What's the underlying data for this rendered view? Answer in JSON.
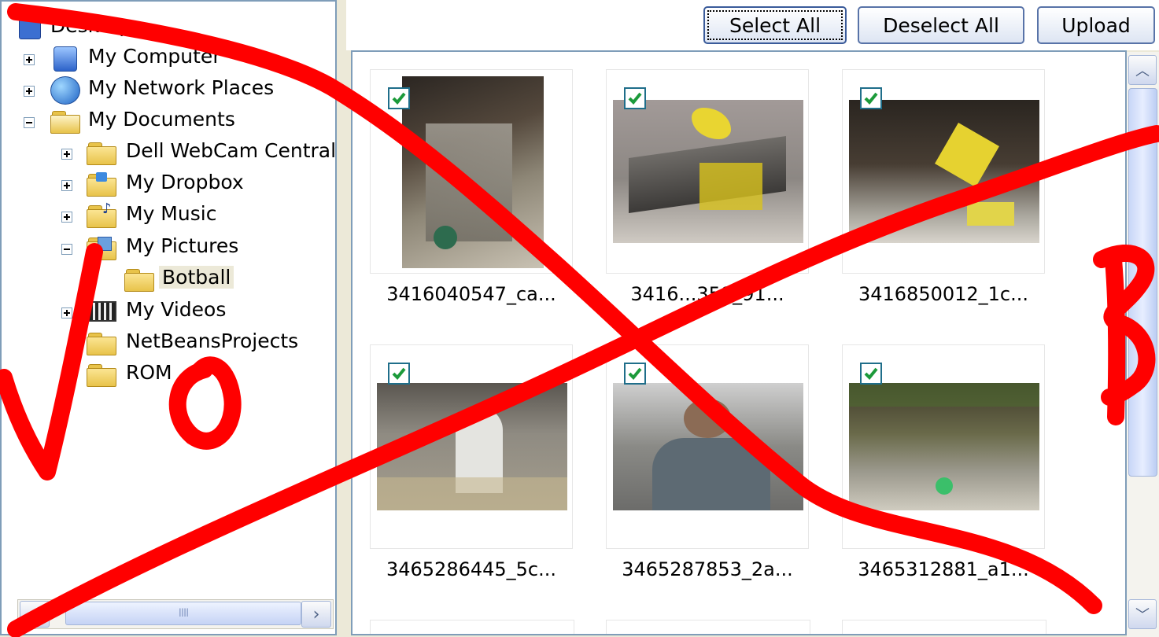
{
  "tree": {
    "items": [
      {
        "label": "Desktop",
        "kind": "desktop"
      },
      {
        "label": "My Computer",
        "kind": "computer"
      },
      {
        "label": "My Network Places",
        "kind": "network"
      },
      {
        "label": "My Documents",
        "kind": "documents"
      },
      {
        "label": "Dell WebCam Central",
        "kind": "folder"
      },
      {
        "label": "My Dropbox",
        "kind": "dropbox"
      },
      {
        "label": "My Music",
        "kind": "music"
      },
      {
        "label": "My Pictures",
        "kind": "pictures"
      },
      {
        "label": "Botball",
        "kind": "folder",
        "selected": true
      },
      {
        "label": "My Videos",
        "kind": "videos"
      },
      {
        "label": "NetBeansProjects",
        "kind": "folder"
      },
      {
        "label": "ROM",
        "kind": "folder"
      }
    ],
    "hscroll_grip": "IIII"
  },
  "toolbar": {
    "select_all": "Select All",
    "deselect_all": "Deselect All",
    "upload": "Upload"
  },
  "gallery": {
    "photos": [
      {
        "caption": "3416040547_ca...",
        "checked": true
      },
      {
        "caption": "3416...358_91...",
        "checked": true
      },
      {
        "caption": "3416850012_1c...",
        "checked": true
      },
      {
        "caption": "3465286445_5c...",
        "checked": true
      },
      {
        "caption": "3465287853_2a...",
        "checked": true
      },
      {
        "caption": "3465312881_a1...",
        "checked": true
      }
    ]
  },
  "annotation": {
    "color": "#ff0000",
    "letters": [
      "V",
      "O",
      "B"
    ]
  }
}
